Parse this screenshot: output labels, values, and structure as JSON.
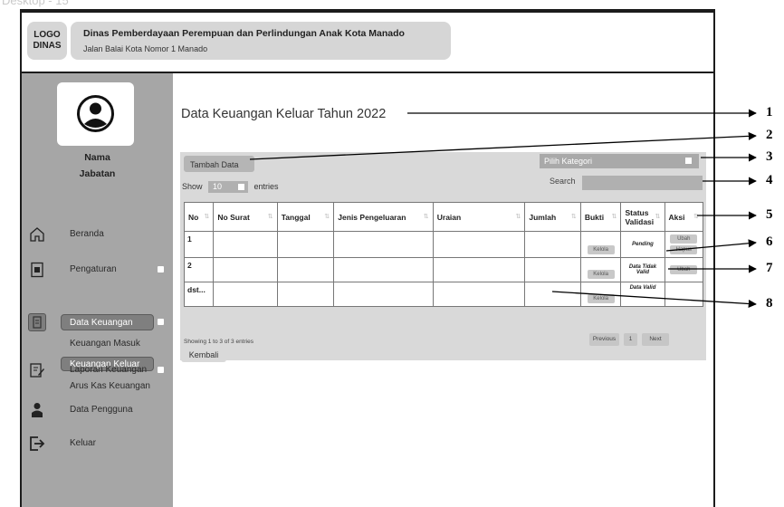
{
  "frame_label": "Desktop - 15",
  "header": {
    "logo": "LOGO\nDINAS",
    "org_name": "Dinas Pemberdayaan Perempuan dan Perlindungan Anak Kota Manado",
    "org_address": "Jalan Balai Kota Nomor 1 Manado"
  },
  "profile": {
    "name": "Nama",
    "role": "Jabatan",
    "icon": "user-avatar-icon"
  },
  "sidebar": {
    "items": [
      {
        "label": "Beranda",
        "icon": "home-icon"
      },
      {
        "label": "Pengaturan",
        "icon": "settings-file-icon"
      },
      {
        "label": "Data Keuangan",
        "icon": "finance-icon"
      },
      {
        "label": "Keuangan Masuk"
      },
      {
        "label": "Keuangan Keluar"
      },
      {
        "label": "Arus Kas Keuangan"
      },
      {
        "label": "Laporan Keuangan",
        "icon": "report-edit-icon"
      },
      {
        "label": "Data Pengguna",
        "icon": "user-icon"
      },
      {
        "label": "Keluar",
        "icon": "logout-icon"
      }
    ]
  },
  "page": {
    "title": "Data Keuangan Keluar Tahun 2022"
  },
  "toolbar": {
    "add_label": "Tambah Data",
    "category_placeholder": "Pilih Kategori",
    "show_label": "Show",
    "entries_value": "10",
    "entries_label": "entries",
    "search_label": "Search"
  },
  "table": {
    "headers": [
      "No",
      "No Surat",
      "Tanggal",
      "Jenis Pengeluaran",
      "Uraian",
      "Jumlah",
      "Bukti",
      "Status Validasi",
      "Aksi"
    ],
    "rows": [
      {
        "no": "1",
        "bukti": "Kelola",
        "status": "Pending",
        "actions": [
          "Ubah",
          "Hapus"
        ]
      },
      {
        "no": "2",
        "bukti": "Kelola",
        "status": "Data Tidak Valid",
        "actions": [
          "Ubah"
        ]
      },
      {
        "no": "dst...",
        "bukti": "Kelola",
        "status": "Data Valid",
        "actions": []
      }
    ]
  },
  "footer": {
    "showing": "Showing 1 to 3 of 3 entries",
    "previous": "Previous",
    "page": "1",
    "next": "Next",
    "back_label": "Kembali"
  },
  "annotations": [
    "1",
    "2",
    "3",
    "4",
    "5",
    "6",
    "7",
    "8"
  ]
}
